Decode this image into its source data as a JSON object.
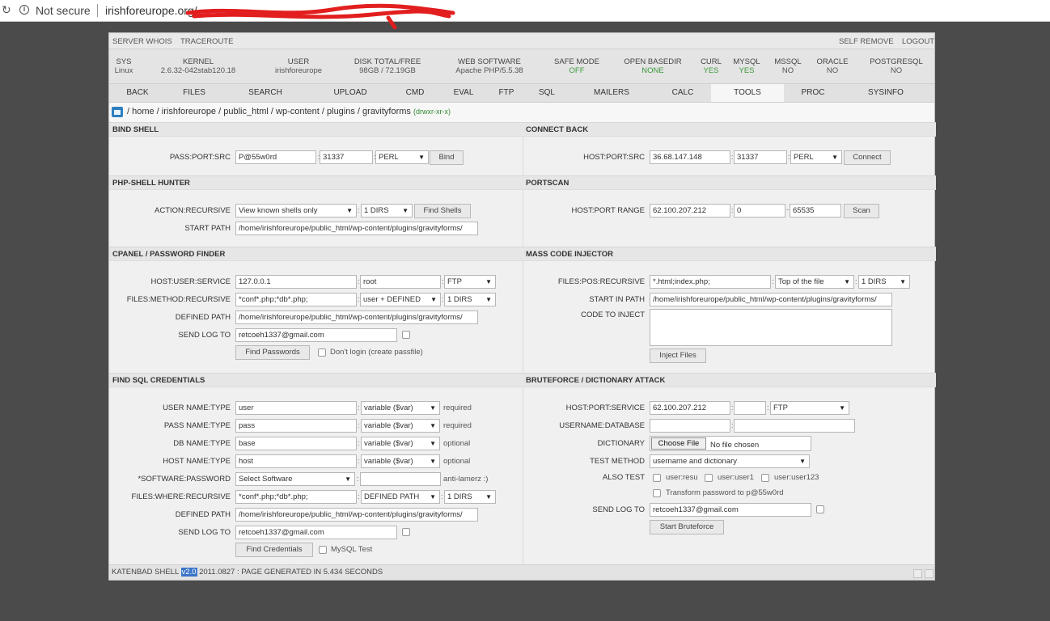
{
  "browser": {
    "security_label": "Not secure",
    "url": "irishforeurope.org/"
  },
  "topnav": {
    "server_whois": "SERVER WHOIS",
    "traceroute": "TRACEROUTE",
    "self_remove": "SELF REMOVE",
    "logout": "LOGOUT"
  },
  "sysinfo": [
    {
      "h": "SYS",
      "v": "Linux"
    },
    {
      "h": "KERNEL",
      "v": "2.6.32-042stab120.18"
    },
    {
      "h": "USER",
      "v": "irishforeurope"
    },
    {
      "h": "DISK TOTAL/FREE",
      "v": "98GB / 72.19GB"
    },
    {
      "h": "WEB SOFTWARE",
      "v": "Apache PHP/5.5.38"
    },
    {
      "h": "SAFE MODE",
      "v": "OFF"
    },
    {
      "h": "OPEN BASEDIR",
      "v": "NONE"
    },
    {
      "h": "CURL",
      "v": "YES"
    },
    {
      "h": "MYSQL",
      "v": "YES"
    },
    {
      "h": "MSSQL",
      "v": "NO"
    },
    {
      "h": "ORACLE",
      "v": "NO"
    },
    {
      "h": "POSTGRESQL",
      "v": "NO"
    }
  ],
  "tabs": [
    "BACK",
    "FILES",
    "SEARCH",
    "UPLOAD",
    "CMD",
    "EVAL",
    "FTP",
    "SQL",
    "MAILERS",
    "CALC",
    "TOOLS",
    "PROC",
    "SYSINFO"
  ],
  "path": {
    "text": "/ home / irishforeurope / public_html / wp-content / plugins / gravityforms",
    "perm": "(drwxr-xr-x)"
  },
  "bind_shell": {
    "title": "BIND SHELL",
    "label": "PASS:PORT:SRC",
    "pass": "P@55w0rd",
    "port": "31337",
    "src": "PERL",
    "button": "Bind"
  },
  "connect_back": {
    "title": "CONNECT BACK",
    "label": "HOST:PORT:SRC",
    "host": "36.68.147.148",
    "port": "31337",
    "src": "PERL",
    "button": "Connect"
  },
  "shell_hunter": {
    "title": "PHP-SHELL HUNTER",
    "label_action": "ACTION:RECURSIVE",
    "action": "View known shells only",
    "dirs": "1 DIRS",
    "button": "Find Shells",
    "label_start": "START PATH",
    "start_path": "/home/irishforeurope/public_html/wp-content/plugins/gravityforms/"
  },
  "portscan": {
    "title": "PORTSCAN",
    "label": "HOST:PORT RANGE",
    "host": "62.100.207.212",
    "from": "0",
    "to": "65535",
    "button": "Scan"
  },
  "cpanel": {
    "title": "CPANEL / PASSWORD FINDER",
    "label_hus": "HOST:USER:SERVICE",
    "host": "127.0.0.1",
    "user": "root",
    "service": "FTP",
    "label_fmr": "FILES:METHOD:RECURSIVE",
    "files": "*conf*.php;*db*.php;",
    "method": "user + DEFINED",
    "dirs": "1 DIRS",
    "label_defined": "DEFINED PATH",
    "defined_path": "/home/irishforeurope/public_html/wp-content/plugins/gravityforms/",
    "label_log": "SEND LOG TO",
    "log": "retcoeh1337@gmail.com",
    "button": "Find Passwords",
    "dont_login": "Don't login (create passfile)"
  },
  "mass_injector": {
    "title": "MASS CODE INJECTOR",
    "label_fpr": "FILES:POS:RECURSIVE",
    "files": "*.html;index.php;",
    "pos": "Top of the file",
    "dirs": "1 DIRS",
    "label_start": "START IN PATH",
    "start_path": "/home/irishforeurope/public_html/wp-content/plugins/gravityforms/",
    "label_code": "CODE TO INJECT",
    "button": "Inject Files"
  },
  "sql_creds": {
    "title": "FIND SQL CREDENTIALS",
    "rows": [
      {
        "label": "USER NAME:TYPE",
        "value": "user",
        "type": "variable ($var)",
        "note": "required"
      },
      {
        "label": "PASS NAME:TYPE",
        "value": "pass",
        "type": "variable ($var)",
        "note": "required"
      },
      {
        "label": "DB NAME:TYPE",
        "value": "base",
        "type": "variable ($var)",
        "note": "optional"
      },
      {
        "label": "HOST NAME:TYPE",
        "value": "host",
        "type": "variable ($var)",
        "note": "optional"
      }
    ],
    "label_software": "*SOFTWARE:PASSWORD",
    "software": "Select Software",
    "software_note": "anti-lamerz :)",
    "label_fwr": "FILES:WHERE:RECURSIVE",
    "files": "*conf*.php;*db*.php;",
    "where": "DEFINED PATH",
    "dirs": "1 DIRS",
    "label_defined": "DEFINED PATH",
    "defined_path": "/home/irishforeurope/public_html/wp-content/plugins/gravityforms/",
    "label_log": "SEND LOG TO",
    "log": "retcoeh1337@gmail.com",
    "button": "Find Credentials",
    "mysql_test": "MySQL Test"
  },
  "bruteforce": {
    "title": "BRUTEFORCE / DICTIONARY ATTACK",
    "label_hps": "HOST:PORT:SERVICE",
    "host": "62.100.207.212",
    "port": "",
    "service": "FTP",
    "label_ud": "USERNAME:DATABASE",
    "label_dict": "DICTIONARY",
    "choose_file": "Choose File",
    "no_file": "No file chosen",
    "label_method": "TEST METHOD",
    "method": "username and dictionary",
    "label_also": "ALSO TEST",
    "also": [
      "user:resu",
      "user:user1",
      "user:user123"
    ],
    "transform": "Transform password to p@55w0rd",
    "label_log": "SEND LOG TO",
    "log": "retcoeh1337@gmail.com",
    "button": "Start Bruteforce"
  },
  "footer": {
    "prefix": "KATENBAD SHELL ",
    "version": "v2.0",
    "suffix": " 2011.0827 : PAGE GENERATED IN 5.434 SECONDS"
  },
  "colors": {
    "accent_green": "#3a9a3a",
    "highlight_blue": "#3b74c9"
  }
}
